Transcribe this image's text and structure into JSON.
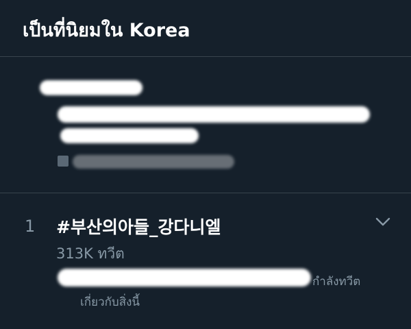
{
  "header": {
    "title": "เป็นที่นิยมใน Korea"
  },
  "news_card": {
    "redacted": true
  },
  "trends": [
    {
      "rank": "1",
      "name": "#부산의아들_강다니엘",
      "tweet_count": "313K ทวีต",
      "context_tail": "กำลังทวีต",
      "context_line2": "เกี่ยวกับสิ่งนี้",
      "menu_icon": "chevron-down-icon"
    }
  ],
  "colors": {
    "background": "#15202b",
    "divider": "#38444d",
    "secondary_text": "#8899a6",
    "primary_text": "#ffffff"
  }
}
